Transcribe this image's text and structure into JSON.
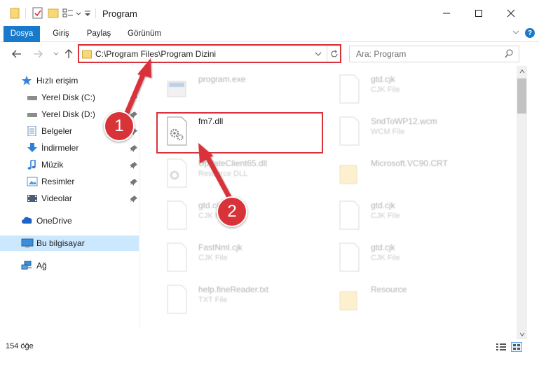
{
  "window": {
    "title": "Program",
    "accent": "#1979ca"
  },
  "ribbon": {
    "tabs": [
      {
        "label": "Dosya",
        "active": true
      },
      {
        "label": "Giriş"
      },
      {
        "label": "Paylaş"
      },
      {
        "label": "Görünüm"
      }
    ]
  },
  "address": {
    "path": "C:\\Program Files\\Program Dizini",
    "refresh_icon": "refresh-icon",
    "chevron_icon": "chevron-down-icon"
  },
  "search": {
    "placeholder": "Ara: Program"
  },
  "sidebar": {
    "items": [
      {
        "label": "Hızlı erişim",
        "icon": "star-icon"
      },
      {
        "label": "Yerel Disk (C:)",
        "icon": "drive-icon",
        "pinned": true
      },
      {
        "label": "Yerel Disk (D:)",
        "icon": "drive-icon",
        "pinned": true
      },
      {
        "label": "Belgeler",
        "icon": "documents-icon",
        "pinned": true
      },
      {
        "label": "İndirmeler",
        "icon": "download-icon",
        "pinned": true
      },
      {
        "label": "Müzik",
        "icon": "music-icon",
        "pinned": true
      },
      {
        "label": "Resimler",
        "icon": "pictures-icon",
        "pinned": true
      },
      {
        "label": "Videolar",
        "icon": "video-icon",
        "pinned": true
      },
      {
        "label": "OneDrive",
        "icon": "cloud-icon"
      },
      {
        "label": "Bu bilgisayar",
        "icon": "computer-icon",
        "selected": true
      },
      {
        "label": "Ağ",
        "icon": "network-icon"
      }
    ]
  },
  "files": [
    {
      "name": "program.exe",
      "type": "",
      "icon": "exe-icon",
      "faded": true
    },
    {
      "name": "gtd.cjk",
      "type": "CJK File",
      "icon": "file-icon",
      "faded": true
    },
    {
      "name": "fm7.dll",
      "type": "",
      "icon": "dll-gear-icon",
      "faded": false
    },
    {
      "name": "SndToWP12.wcm",
      "type": "WCM File",
      "icon": "file-icon",
      "faded": true
    },
    {
      "name": "UpdateClient65.dll",
      "type": "Resource DLL",
      "icon": "dll-gear-icon",
      "faded": true
    },
    {
      "name": "Microsoft.VC90.CRT",
      "type": "",
      "icon": "folder-icon",
      "faded": true
    },
    {
      "name": "gtd.cjk",
      "type": "CJK File",
      "icon": "file-icon",
      "faded": true
    },
    {
      "name": "gtd.cjk",
      "type": "CJK File",
      "icon": "file-icon",
      "faded": true
    },
    {
      "name": "FastNml.cjk",
      "type": "CJK File",
      "icon": "file-icon",
      "faded": true
    },
    {
      "name": "gtd.cjk",
      "type": "CJK File",
      "icon": "file-icon",
      "faded": true
    },
    {
      "name": "help.fineReader.txt",
      "type": "TXT File",
      "icon": "file-icon",
      "faded": true
    },
    {
      "name": "Resource",
      "type": "",
      "icon": "folder-icon",
      "faded": true
    }
  ],
  "status": {
    "count": "154 öğe"
  },
  "annotations": {
    "badges": [
      "1",
      "2"
    ],
    "color": "#d9333a"
  }
}
